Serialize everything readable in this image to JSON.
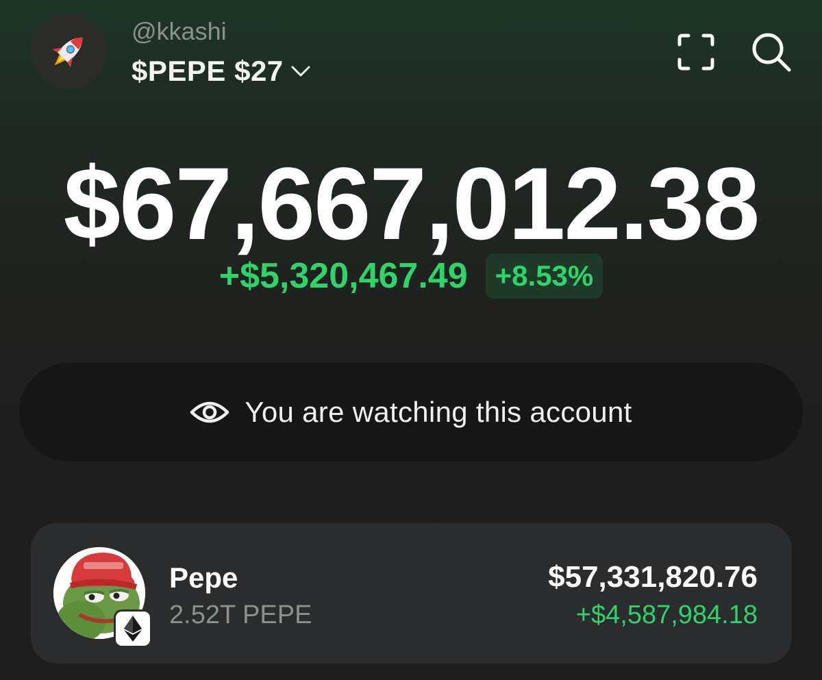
{
  "header": {
    "avatar_icon": "rocket-icon",
    "username": "@kkashi",
    "account_label": "$PEPE $27",
    "dropdown_icon": "chevron-down-icon",
    "scan_icon": "scan-icon",
    "search_icon": "search-icon"
  },
  "portfolio": {
    "balance": "$67,667,012.38",
    "change_amount": "+$5,320,467.49",
    "change_percent": "+8.53%"
  },
  "watch_banner": {
    "icon": "eye-icon",
    "text": "You are watching this account"
  },
  "tokens": [
    {
      "name": "Pepe",
      "amount": "2.52T PEPE",
      "value": "$57,331,820.76",
      "change": "+$4,587,984.18",
      "logo_icon": "pepe-frog-icon",
      "chain_icon": "ethereum-icon"
    }
  ],
  "colors": {
    "positive": "#2ed46a",
    "background_top": "#1d3527",
    "background_bottom": "#1e1e1e",
    "card": "#2b2c2e"
  }
}
